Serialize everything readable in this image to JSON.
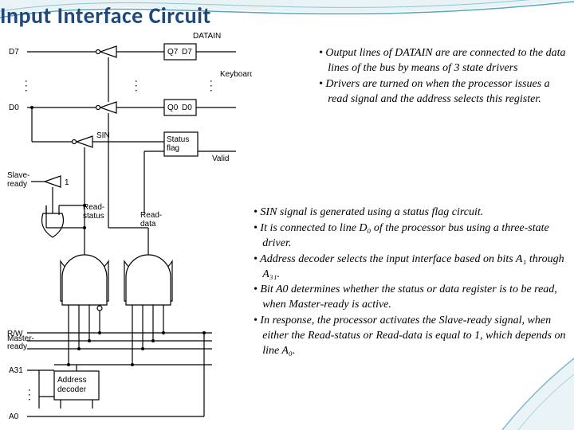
{
  "title": "Input Interface Circuit",
  "diagram": {
    "labels": {
      "datain": "DATAIN",
      "d7": "D7",
      "d0": "D0",
      "q7": "Q7",
      "q0": "Q0",
      "q_d7": "D7",
      "q_d0": "D0",
      "kbd": "Keyboard data",
      "sin": "SIN",
      "status": "Status flag",
      "valid": "Valid",
      "one": "1",
      "slave": "Slave-ready",
      "readstatus": "Read-status",
      "readdata": "Read-data",
      "rw": "R/W",
      "master": "Master-ready",
      "a31": "A31",
      "a0": "A0",
      "decoder": "Address decoder"
    }
  },
  "para1": [
    "Output lines of  DATAIN are are connected to the data lines of the bus by means of 3 state drivers",
    "Drivers are turned on when the processor issues a read signal and the address selects this register."
  ],
  "para2": [
    "SIN signal is generated using a status flag circuit.",
    "It is connected to line D₀ of the processor bus using a three-state driver.",
    "Address decoder selects the input interface based on bits A₁ through A₃₁.",
    "Bit A0 determines whether the status or data register is to be read, when Master-ready is active.",
    "In response, the processor activates the Slave-ready signal, when either the Read-status or Read-data is equal to 1, which depends on line A₀."
  ]
}
